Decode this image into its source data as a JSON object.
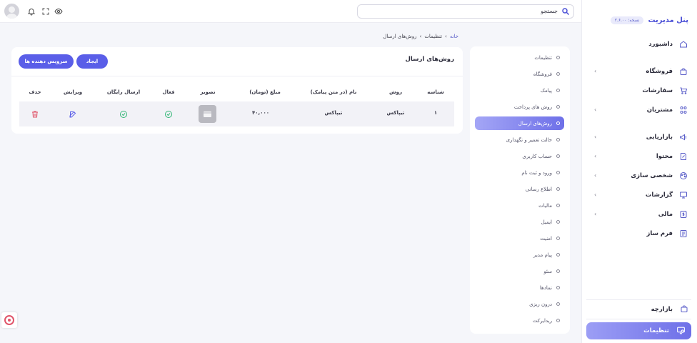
{
  "brand": {
    "title": "پنل مدیریت",
    "version": "نسخه: ۲.۶.۰۰"
  },
  "nav": {
    "dashboard": "داشبورد",
    "store": "فروشگاه",
    "orders": "سفارشات",
    "customers": "مشتریان",
    "marketing": "بازاریابی",
    "content": "محتوا",
    "personalization": "شخصی سازی",
    "reports": "گزارشات",
    "finance": "مالی",
    "form_builder": "فرم ساز",
    "bazarche": "بازارچه",
    "settings": "تنظیمات"
  },
  "search": {
    "placeholder": "جستجو"
  },
  "breadcrumb": {
    "home": "خانه",
    "settings": "تنظیمات",
    "current": "روش‌های ارسال"
  },
  "submenu": [
    "تنظیمات",
    "فروشگاه",
    "پیامک",
    "روش های پرداخت",
    "روش‌های ارسال",
    "حالت تعمیر و نگهداری",
    "حساب کاربری",
    "ورود و ثبت نام",
    "اطلاع رسانی",
    "مالیات",
    "ایمیل",
    "امنیت",
    "پیام مدیر",
    "سئو",
    "نمادها",
    "درون ریزی",
    "ریدایرکت"
  ],
  "submenu_active_index": 4,
  "card": {
    "title": "روش‌های ارسال",
    "create_button": "ایجاد",
    "providers_button": "سرویس دهنده ها",
    "columns": [
      "شناسه",
      "روش",
      "نام (در متن پیامک)",
      "مبلغ (تومان)",
      "تصویر",
      "فعال",
      "ارسال رایگان",
      "ویرایش",
      "حذف"
    ],
    "rows": [
      {
        "id": "۱",
        "method": "تیپاکس",
        "name": "تیپاکس",
        "amount": "۴۰,۰۰۰",
        "active": true,
        "free_shipping": true
      }
    ]
  },
  "colors": {
    "accent": "#5a5ee8",
    "success": "#2fb574",
    "danger": "#e0556a"
  }
}
